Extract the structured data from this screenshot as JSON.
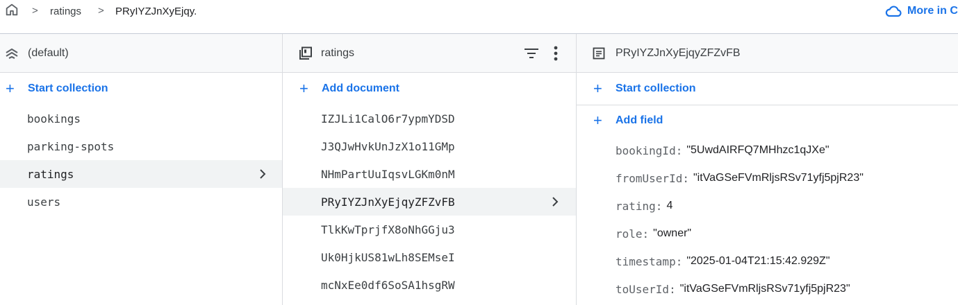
{
  "breadcrumb": {
    "items": [
      "ratings",
      "PRyIYZJnXyEjqy."
    ],
    "separator": ">"
  },
  "header_action": {
    "label": "More in C"
  },
  "panel_root": {
    "title": "(default)",
    "start_collection_label": "Start collection",
    "collections": [
      {
        "label": "bookings",
        "selected": false
      },
      {
        "label": "parking-spots",
        "selected": false
      },
      {
        "label": "ratings",
        "selected": true
      },
      {
        "label": "users",
        "selected": false
      }
    ]
  },
  "panel_collection": {
    "title": "ratings",
    "add_document_label": "Add document",
    "documents": [
      {
        "label": "IZJLi1CalO6r7ypmYDSD",
        "selected": false
      },
      {
        "label": "J3QJwHvkUnJzX1o11GMp",
        "selected": false
      },
      {
        "label": "NHmPartUuIqsvLGKm0nM",
        "selected": false
      },
      {
        "label": "PRyIYZJnXyEjqyZFZvFB",
        "selected": true
      },
      {
        "label": "TlkKwTprjfX8oNhGGju3",
        "selected": false
      },
      {
        "label": "Uk0HjkUS81wLh8SEMseI",
        "selected": false
      },
      {
        "label": "mcNxEe0df6SoSA1hsgRW",
        "selected": false
      }
    ]
  },
  "panel_document": {
    "title": "PRyIYZJnXyEjqyZFZvFB",
    "start_collection_label": "Start collection",
    "add_field_label": "Add field",
    "fields": [
      {
        "key": "bookingId:",
        "value": "\"5UwdAIRFQ7MHhzc1qJXe\""
      },
      {
        "key": "fromUserId:",
        "value": "\"itVaGSeFVmRljsRSv71yfj5pjR23\""
      },
      {
        "key": "rating:",
        "value": "4"
      },
      {
        "key": "role:",
        "value": "\"owner\""
      },
      {
        "key": "timestamp:",
        "value": "\"2025-01-04T21:15:42.929Z\""
      },
      {
        "key": "toUserId:",
        "value": "\"itVaGSeFVmRljsRSv71yfj5pjR23\""
      }
    ]
  },
  "colors": {
    "accent": "#1a73e8",
    "selected_row": "#f1f3f4",
    "panel_header": "#f8f9fa",
    "divider": "#dadce0"
  },
  "icons": {
    "home": "home-icon",
    "cloud": "cloud-icon",
    "database": "database-icon",
    "collection": "collection-icon",
    "document": "document-icon",
    "filter": "filter-icon",
    "more": "more-vert-icon",
    "chevron": "chevron-right-icon"
  }
}
